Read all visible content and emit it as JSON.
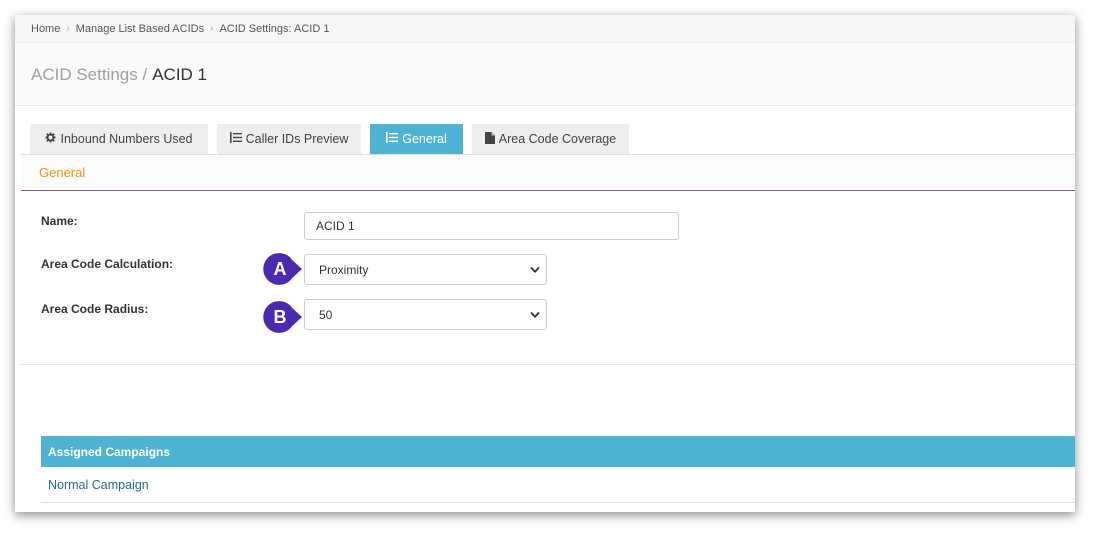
{
  "breadcrumb": [
    "Home",
    "Manage List Based ACIDs",
    "ACID Settings: ACID 1"
  ],
  "header": {
    "prefix": "ACID Settings /",
    "name": "ACID 1"
  },
  "tabs": [
    {
      "label": "Inbound Numbers Used",
      "icon": "gear-icon",
      "active": false
    },
    {
      "label": "Caller IDs Preview",
      "icon": "list-icon",
      "active": false
    },
    {
      "label": "General",
      "icon": "list-icon",
      "active": true
    },
    {
      "label": "Area Code Coverage",
      "icon": "file-icon",
      "active": false
    }
  ],
  "section": {
    "title": "General"
  },
  "form": {
    "name_label": "Name:",
    "name_value": "ACID 1",
    "calc_label": "Area Code Calculation:",
    "calc_value": "Proximity",
    "radius_label": "Area Code Radius:",
    "radius_value": "50"
  },
  "markers": {
    "a": "A",
    "b": "B",
    "color": "#4a2bb0"
  },
  "campaigns": {
    "header": "Assigned Campaigns",
    "items": [
      "Normal Campaign"
    ]
  },
  "colors": {
    "accent": "#4fb3d3",
    "section_title": "#f0931d",
    "link": "#2a6aa0"
  }
}
